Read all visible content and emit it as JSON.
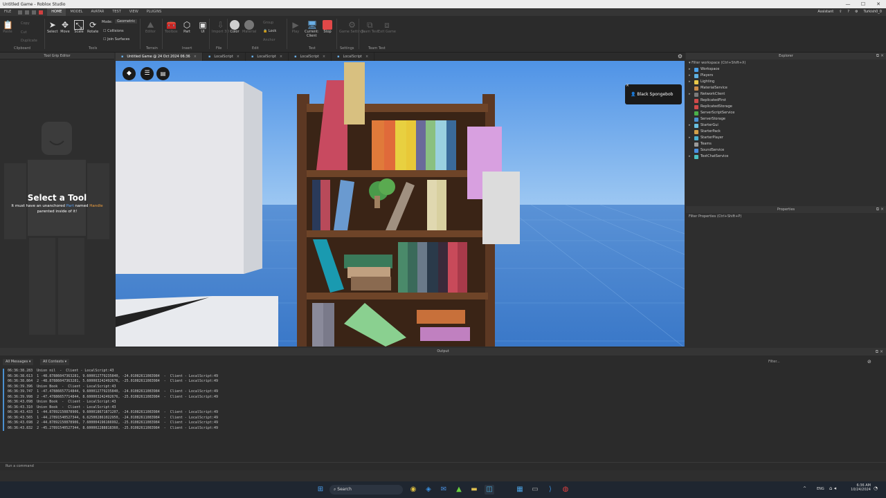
{
  "window": {
    "title": "Untitled Game - Roblox Studio",
    "controls": [
      "—",
      "☐",
      "✕"
    ]
  },
  "menubar": {
    "file": "FILE",
    "tabs": [
      "HOME",
      "MODEL",
      "AVATAR",
      "TEST",
      "VIEW",
      "PLUGINS"
    ],
    "assistant": "Assistant",
    "user": "Turkish0_0"
  },
  "ribbon": {
    "clipboard": {
      "paste": "Paste",
      "copy": "Copy",
      "cut": "Cut",
      "duplicate": "Duplicate",
      "group": "Clipboard"
    },
    "tools": {
      "select": "Select",
      "move": "Move",
      "scale": "Scale",
      "rotate": "Rotate",
      "mode_label": "Mode:",
      "mode_value": "Geometric",
      "collisions": "Collisions",
      "join": "Join Surfaces",
      "group": "Tools"
    },
    "terrain": {
      "editor": "Editor",
      "group": "Terrain"
    },
    "insert": {
      "toolbox": "Toolbox",
      "part": "Part",
      "ui": "UI",
      "group": "Insert"
    },
    "file": {
      "import3d": "Import 3D",
      "group": "File"
    },
    "edit": {
      "color": "Color",
      "material": "Material",
      "group_btn": "Group",
      "lock": "Lock",
      "anchor": "Anchor",
      "group": "Edit"
    },
    "test": {
      "play": "Play",
      "current": "Current:",
      "client": "Client",
      "stop": "Stop",
      "group": "Test"
    },
    "settings": {
      "game_settings": "Game Settings",
      "group": "Settings"
    },
    "teamtest": {
      "team_test": "Team Test",
      "exit_game": "Exit Game",
      "group": "Team Test"
    }
  },
  "left_panel": {
    "title": "Tool Grip Editor",
    "heading": "Select a Tool",
    "line1_a": "It must have an unanchored ",
    "line1_part": "Part",
    "line1_b": " named ",
    "line1_handle": "Handle",
    "line2": "parented inside of it!"
  },
  "tabs": [
    {
      "label": "Untitled Game @ 24 Oct 2024 06:36",
      "active": true
    },
    {
      "label": "LocalScript",
      "active": false
    },
    {
      "label": "LocalScript",
      "active": false
    },
    {
      "label": "LocalScript",
      "active": false
    },
    {
      "label": "LocalScript",
      "active": false
    }
  ],
  "viewport": {
    "player_tag": "Black Spongebob"
  },
  "explorer": {
    "title": "Explorer",
    "filter": "Filter workspace (Ctrl+Shift+X)",
    "items": [
      {
        "label": "Workspace",
        "color": "#4aa0e8",
        "expandable": true
      },
      {
        "label": "Players",
        "color": "#5fb0e0",
        "expandable": true
      },
      {
        "label": "Lighting",
        "color": "#e8c84a",
        "expandable": true
      },
      {
        "label": "MaterialService",
        "color": "#c98a4a",
        "expandable": false
      },
      {
        "label": "NetworkClient",
        "color": "#7a7a7a",
        "expandable": true
      },
      {
        "label": "ReplicatedFirst",
        "color": "#d04a4a",
        "expandable": false
      },
      {
        "label": "ReplicatedStorage",
        "color": "#d04a4a",
        "expandable": false
      },
      {
        "label": "ServerScriptService",
        "color": "#4ab04a",
        "expandable": false
      },
      {
        "label": "ServerStorage",
        "color": "#4a90d0",
        "expandable": false
      },
      {
        "label": "StarterGui",
        "color": "#6ac0e0",
        "expandable": true
      },
      {
        "label": "StarterPack",
        "color": "#d0a04a",
        "expandable": false
      },
      {
        "label": "StarterPlayer",
        "color": "#4ab0d0",
        "expandable": true
      },
      {
        "label": "Teams",
        "color": "#9a9a9a",
        "expandable": false
      },
      {
        "label": "SoundService",
        "color": "#4a90e0",
        "expandable": false
      },
      {
        "label": "TextChatService",
        "color": "#4ac0c0",
        "expandable": true
      }
    ]
  },
  "properties": {
    "title": "Properties",
    "filter": "Filter Properties (Ctrl+Shift+P)"
  },
  "output": {
    "title": "Output",
    "messages_filter": "All Messages",
    "contexts_filter": "All Contexts",
    "filter_placeholder": "Filter...",
    "lines": [
      "06:36:38.283  Union nil  -  Client - LocalScript:43",
      "06:36:38.613  1 -48.87886047363281, 9.600012779235840, -24.01082611083984  -  Client - LocalScript:49",
      "06:36:38.864  2 -48.87886047363281, 5.600003242492676, -25.01082611083984  -  Client - LocalScript:49",
      "06:36:39.396  Union Book  -  Client - LocalScript:43",
      "06:36:39.747  1 -47.47886657714844, 9.600012779235840, -24.01082611083984  -  Client - LocalScript:49",
      "06:36:39.998  2 -47.47886657714844, 8.600003242492676, -25.01082611083984  -  Client - LocalScript:49",
      "06:36:43.098  Union Book  -  Client - LocalScript:43",
      "06:36:43.310  Union Book  -  Client - LocalScript:43",
      "06:36:43.433  1 -44.87892150878906, 9.600018671871207, -24.01082611083984  -  Client - LocalScript:49",
      "06:36:43.565  1 -44.27891540527344, 6.625002861022950, -24.01082611083984  -  Client - LocalScript:49",
      "06:36:43.698  2 -44.87892150878906, 7.600004196166992, -25.01082611083984  -  Client - LocalScript:49",
      "06:36:43.832  2 -45.27891540527344, 8.600002288818360, -25.01082611083984  -  Client - LocalScript:49"
    ]
  },
  "command_bar": {
    "placeholder": "Run a command"
  },
  "taskbar": {
    "search": "Search",
    "lang": "ENG",
    "time": "6:36 AM",
    "date": "10/24/2024"
  }
}
